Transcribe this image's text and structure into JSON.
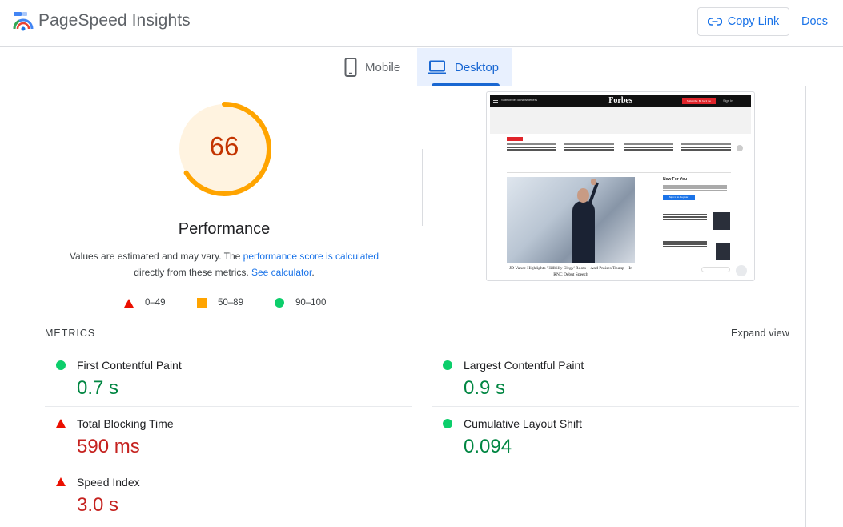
{
  "app": {
    "title": "PageSpeed Insights"
  },
  "header": {
    "copy_link_label": "Copy Link",
    "docs_label": "Docs"
  },
  "tabs": [
    {
      "label": "Mobile",
      "active": false
    },
    {
      "label": "Desktop",
      "active": true
    }
  ],
  "score": {
    "value": "66",
    "fraction": 0.66,
    "color": "#ffa400",
    "bg_color": "#fff3e0",
    "text_color": "#c33300"
  },
  "performance": {
    "title": "Performance",
    "note_part1": "Values are estimated and may vary. The ",
    "note_link1": "performance score is calculated",
    "note_part2": " directly from these metrics. ",
    "note_link2": "See calculator",
    "note_part3": "."
  },
  "legend": [
    {
      "icon": "fail-triangle-icon",
      "label": "0–49"
    },
    {
      "icon": "average-square-icon",
      "label": "50–89"
    },
    {
      "icon": "pass-circle-icon",
      "label": "90–100"
    }
  ],
  "screenshot": {
    "site_logo": "Forbes",
    "headline": "JD Vance Highlights 'Hillbilly Elegy' Roots—And Praises Trump—In RNC Debut Speech",
    "sidebar_title": "New For You",
    "sidebar_button": "Sign in to Register",
    "nav_button": "Subscribe: $1 for 3 mo",
    "sign_in": "Sign In",
    "newsletters": "Subscribe To Newsletters"
  },
  "metrics_section": {
    "label": "METRICS",
    "expand_label": "Expand view"
  },
  "metrics": [
    {
      "name": "First Contentful Paint",
      "value": "0.7 s",
      "status": "good"
    },
    {
      "name": "Largest Contentful Paint",
      "value": "0.9 s",
      "status": "good"
    },
    {
      "name": "Total Blocking Time",
      "value": "590 ms",
      "status": "bad"
    },
    {
      "name": "Cumulative Layout Shift",
      "value": "0.094",
      "status": "good"
    },
    {
      "name": "Speed Index",
      "value": "3.0 s",
      "status": "bad"
    }
  ],
  "colors": {
    "accent": "#1a73e8",
    "good": "#018642",
    "bad": "#c5221f",
    "average": "#ffa400"
  }
}
